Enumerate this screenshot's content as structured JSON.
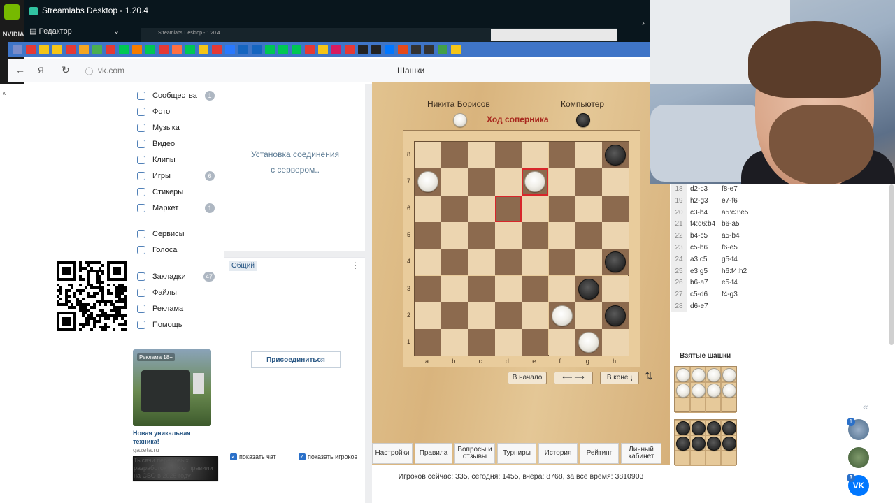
{
  "streamlabs": {
    "nvidia_label": "NVIDIA",
    "side_letter": "к",
    "title": "Streamlabs Desktop - 1.20.4",
    "editor_label": "Редактор",
    "inner_title": "Streamlabs Desktop - 1.20.4"
  },
  "browser": {
    "url": "vk.com",
    "page_title": "Шашки",
    "bookmark_colors": [
      "#7a8cc9",
      "#e53935",
      "#f5c518",
      "#f5c518",
      "#e53935",
      "#f5a623",
      "#4caf50",
      "#e53935",
      "#00c853",
      "#f57c00",
      "#00c853",
      "#e53935",
      "#ff7043",
      "#00c853",
      "#f5c518",
      "#e53935",
      "#2979ff",
      "#1565c0",
      "#1565c0",
      "#00c853",
      "#00c853",
      "#00c853",
      "#e53935",
      "#f5c518",
      "#d81b60",
      "#e53935",
      "#222222",
      "#222222",
      "#0077ff",
      "#e64a19",
      "#333333",
      "#333333",
      "#43a047",
      "#f5c518"
    ]
  },
  "sidebar": {
    "items": [
      {
        "label": "Сообщества",
        "badge": "1"
      },
      {
        "label": "Фото",
        "badge": ""
      },
      {
        "label": "Музыка",
        "badge": ""
      },
      {
        "label": "Видео",
        "badge": ""
      },
      {
        "label": "Клипы",
        "badge": ""
      },
      {
        "label": "Игры",
        "badge": "6"
      },
      {
        "label": "Стикеры",
        "badge": ""
      },
      {
        "label": "Маркет",
        "badge": "1"
      },
      {
        "label": "Сервисы",
        "badge": ""
      },
      {
        "label": "Голоса",
        "badge": ""
      },
      {
        "label": "Закладки",
        "badge": "47"
      },
      {
        "label": "Файлы",
        "badge": ""
      },
      {
        "label": "Реклама",
        "badge": ""
      },
      {
        "label": "Помощь",
        "badge": ""
      }
    ]
  },
  "ad": {
    "tag": "Реклама 18+",
    "title": "Новая уникальная техника!",
    "domain": "gazeta.ru",
    "body": "Тысячи передовых разработок ВПК отправили на СВО в 2025 году"
  },
  "chat": {
    "connecting": "Установка соединения с сервером..",
    "tab": "Общий",
    "join": "Присоединиться",
    "show_chat": "показать чат",
    "show_players": "показать игроков"
  },
  "game": {
    "player_white": "Никита Борисов",
    "player_black": "Компьютер",
    "turn": "Ход соперника",
    "ranks": [
      "8",
      "7",
      "6",
      "5",
      "4",
      "3",
      "2",
      "1"
    ],
    "files": [
      "a",
      "b",
      "c",
      "d",
      "e",
      "f",
      "g",
      "h"
    ],
    "white_pieces": [
      "a7",
      "e7",
      "f2",
      "g1"
    ],
    "black_pieces": [
      "h8",
      "h4",
      "g3",
      "h2"
    ],
    "highlight": [
      "e7",
      "d6"
    ],
    "btn_start": "В начало",
    "btn_arrows": "⟵ ⟶",
    "btn_end": "В конец",
    "tabs": [
      "Настройки",
      "Правила",
      "Вопросы и отзывы",
      "Турниры",
      "История",
      "Рейтинг",
      "Личный кабинет"
    ],
    "stats": "Игроков сейчас: 335, сегодня: 1455, вчера: 8768, за все время: 3810903"
  },
  "moves": [
    {
      "n": "18",
      "w": "d2-c3",
      "b": "f8-e7"
    },
    {
      "n": "19",
      "w": "h2-g3",
      "b": "e7-f6"
    },
    {
      "n": "20",
      "w": "c3-b4",
      "b": "a5:c3:e5"
    },
    {
      "n": "21",
      "w": "f4:d6:b4",
      "b": "b6-a5"
    },
    {
      "n": "22",
      "w": "b4-c5",
      "b": "a5-b4"
    },
    {
      "n": "23",
      "w": "c5-b6",
      "b": "f6-e5"
    },
    {
      "n": "24",
      "w": "a3:c5",
      "b": "g5-f4"
    },
    {
      "n": "25",
      "w": "e3:g5",
      "b": "h6:f4:h2"
    },
    {
      "n": "26",
      "w": "b6-a7",
      "b": "e5-f4"
    },
    {
      "n": "27",
      "w": "c5-d6",
      "b": "f4-g3"
    },
    {
      "n": "28",
      "w": "d6-e7",
      "b": ""
    }
  ],
  "taken": {
    "label": "Взятые шашки",
    "white_count": 8,
    "black_count": 8
  },
  "float": {
    "badge1": "1",
    "badge2": "3"
  }
}
